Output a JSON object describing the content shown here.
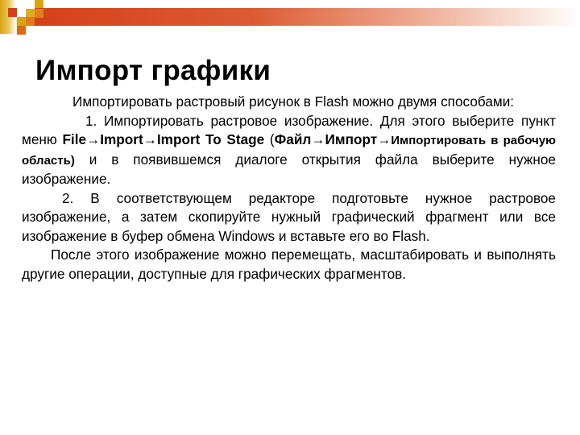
{
  "slide": {
    "title": "Импорт графики",
    "intro": {
      "text": "Импортировать растровый рисунок в Flash можно двумя способами:"
    },
    "item1": {
      "lead": "1. Импортировать растровое изображение. Для этого выберите пункт меню ",
      "menu_path_en": "File→Import→Import To Stage",
      "paren_open": " (",
      "menu_path_ru_main": "Файл→Импорт→",
      "menu_path_ru_small": "Импортировать в рабочую область)",
      "tail": " и в появившемся диалоге открытия файла выберите нужное изображение."
    },
    "item2": {
      "text": "2. В соответствующем редакторе подготовьте нужное растровое изображение, а затем скопируйте нужный графический фрагмент или все изображение в буфер обмена Windows и вставьте его во Flash."
    },
    "conclusion": {
      "text": "После этого изображение можно перемещать, масштабировать и выполнять другие операции, доступные для графических фрагментов."
    }
  },
  "theme": {
    "accent_red": "#d6401a",
    "accent_orange": "#e07a1c",
    "accent_gold": "#d9a412"
  }
}
